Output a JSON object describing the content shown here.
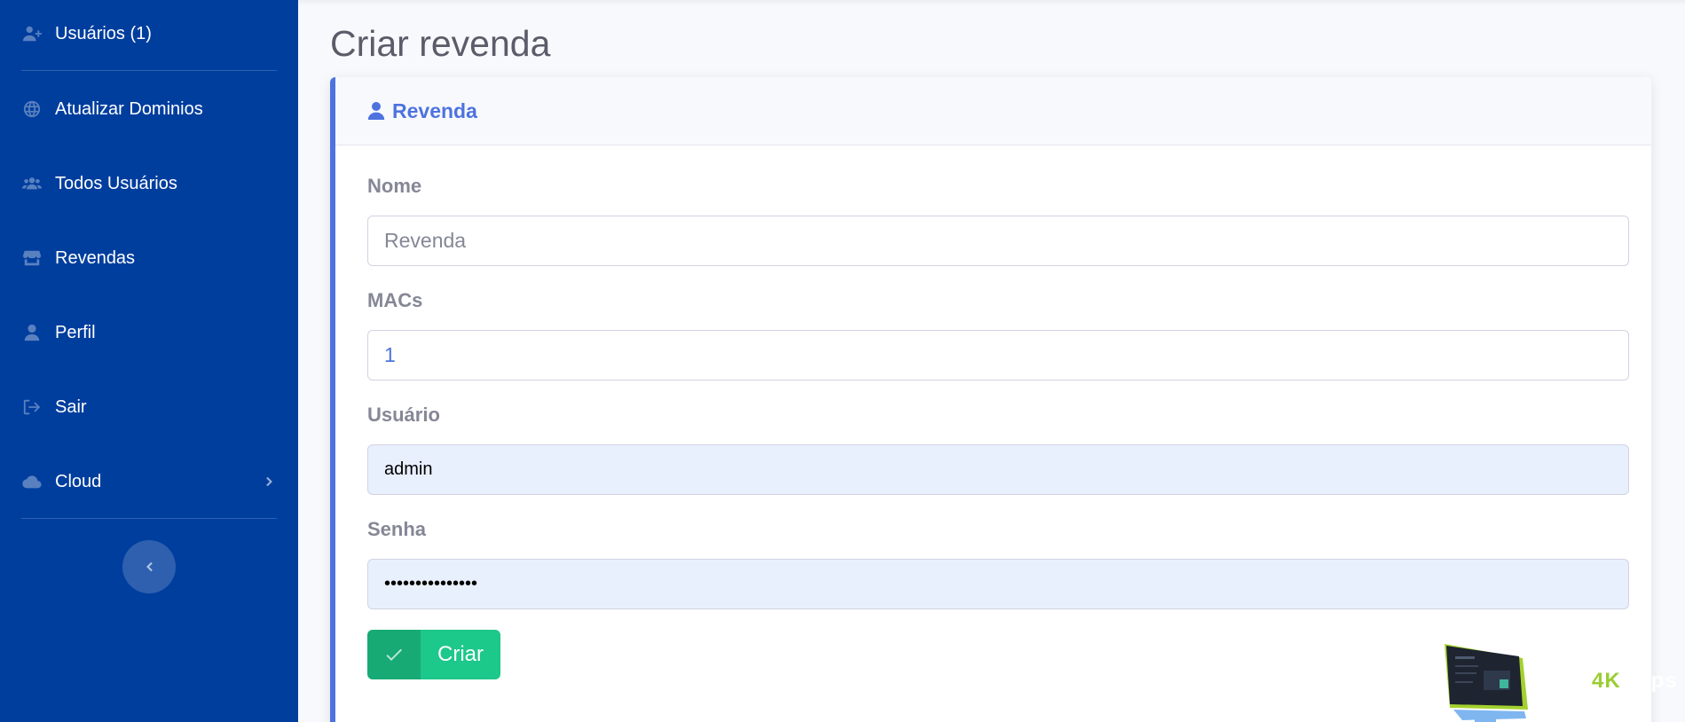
{
  "sidebar": {
    "items": [
      {
        "label": "Usuários (1)",
        "icon": "user-plus-icon"
      },
      {
        "label": "Atualizar Dominios",
        "icon": "globe-icon"
      },
      {
        "label": "Todos Usuários",
        "icon": "users-icon"
      },
      {
        "label": "Revendas",
        "icon": "store-icon"
      },
      {
        "label": "Perfil",
        "icon": "user-icon"
      },
      {
        "label": "Sair",
        "icon": "sign-out-icon"
      },
      {
        "label": "Cloud",
        "icon": "cloud-icon"
      }
    ],
    "collapse_icon": "chevron-left-icon"
  },
  "page": {
    "title": "Criar revenda"
  },
  "card": {
    "title": "Revenda",
    "icon": "user-icon"
  },
  "form": {
    "nome": {
      "label": "Nome",
      "placeholder": "Revenda",
      "value": ""
    },
    "macs": {
      "label": "MACs",
      "value": "1"
    },
    "usuario": {
      "label": "Usuário",
      "value": "admin"
    },
    "senha": {
      "label": "Senha",
      "value": "•••••••••••••••"
    },
    "submit_label": "Criar",
    "submit_icon": "check-icon"
  },
  "watermark": {
    "text_main": "4K",
    "text_faded": "Apps"
  },
  "colors": {
    "sidebar_bg": "#003e9e",
    "primary": "#4e73df",
    "success": "#1cc88a",
    "autofill_bg": "#e8f0fe"
  }
}
